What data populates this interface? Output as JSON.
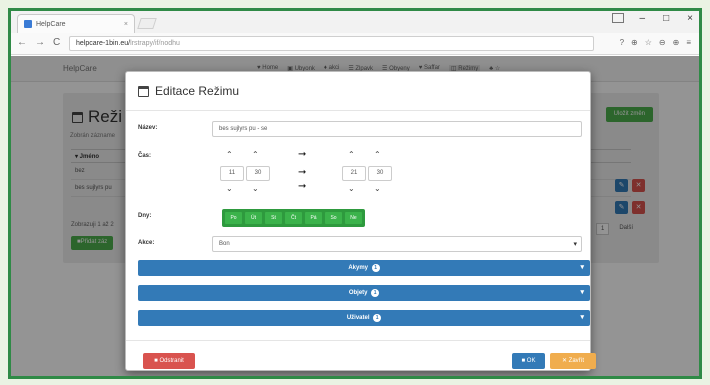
{
  "browser": {
    "tab_title": "HelpCare",
    "tab_close": "×",
    "window_controls": [
      "–",
      "□",
      "×"
    ],
    "nav": [
      "←",
      "→",
      "C"
    ],
    "url_host": "helpcare-1bin.eu/",
    "url_path": "lrstrapy/if/nodhu",
    "ext_icons": [
      "?",
      "⊕",
      "☆",
      "⊖",
      "⊕",
      "≡"
    ]
  },
  "app": {
    "brand": "HelpCare",
    "nav_items": [
      "♥ Home",
      "▣ Ubyonk",
      "♦ akci",
      "☰ Zlpavk",
      "☰ Obyeny",
      "♥ Saffar",
      "◫ Režimy",
      "♣ ☆"
    ],
    "page_title": "Reži",
    "page_subtitle": "Zobrán zázname",
    "table_header": "▾ Jméno",
    "table_rows": [
      "bez",
      "bes sujlyrs pu"
    ],
    "footer_text": "Zobrazuji 1 až 2",
    "add_button": "■Přidat záz",
    "right_button": "Uložit změn",
    "pager": [
      "1",
      "Další"
    ]
  },
  "modal": {
    "title": "Editace Režimu",
    "name_label": "Název:",
    "name_value": "bes sujlyrs pu - se",
    "time_label": "Čas:",
    "time_from_hours": "11",
    "time_from_minutes": "30",
    "time_to_hours": "21",
    "time_to_minutes": "30",
    "days_label": "Dny:",
    "days": [
      "Po",
      "Út",
      "St",
      "Čt",
      "Pá",
      "So",
      "Ne"
    ],
    "action_label": "Akce:",
    "action_value": "Bon",
    "sections": [
      {
        "label": "Akymy",
        "count": "1"
      },
      {
        "label": "Objety",
        "count": "1"
      },
      {
        "label": "Uživatel",
        "count": "1"
      }
    ],
    "delete_button": "■ Odstranit",
    "ok_button": "■ OK",
    "close_button": "✕ Zavřít"
  },
  "colors": {
    "frame": "#2f8a46",
    "primary": "#337ab7",
    "success": "#3bb34b",
    "danger": "#d9534f",
    "warning": "#f0ad4e"
  }
}
